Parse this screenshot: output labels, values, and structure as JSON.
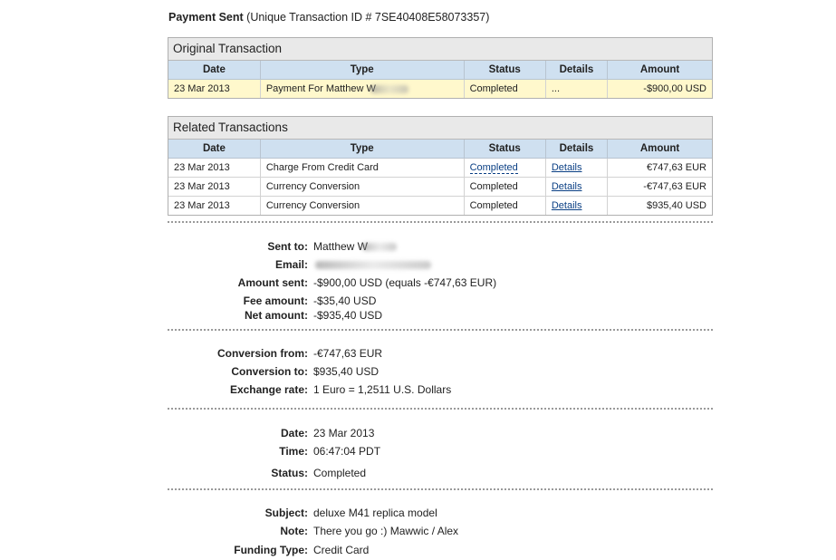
{
  "header": {
    "title": "Payment Sent",
    "transaction_id_text": "(Unique Transaction ID # 7SE40408E58073357)"
  },
  "original": {
    "title": "Original Transaction",
    "columns": [
      "Date",
      "Type",
      "Status",
      "Details",
      "Amount"
    ],
    "row": {
      "date": "23 Mar 2013",
      "type": "Payment For Matthew W",
      "status": "Completed",
      "details": "...",
      "amount": "-$900,00 USD"
    }
  },
  "related": {
    "title": "Related Transactions",
    "columns": [
      "Date",
      "Type",
      "Status",
      "Details",
      "Amount"
    ],
    "rows": [
      {
        "date": "23 Mar 2013",
        "type": "Charge From Credit Card",
        "status": "Completed",
        "details": "Details",
        "amount": "€747,63 EUR"
      },
      {
        "date": "23 Mar 2013",
        "type": "Currency Conversion",
        "status": "Completed",
        "details": "Details",
        "amount": "-€747,63 EUR"
      },
      {
        "date": "23 Mar 2013",
        "type": "Currency Conversion",
        "status": "Completed",
        "details": "Details",
        "amount": "$935,40 USD"
      }
    ]
  },
  "summary": {
    "sent_to_label": "Sent to:",
    "sent_to": "Matthew W",
    "email_label": "Email:",
    "amount_sent_label": "Amount sent:",
    "amount_sent": "-$900,00 USD (equals -€747,63 EUR)",
    "fee_label": "Fee amount:",
    "fee": "-$35,40 USD",
    "net_label": "Net amount:",
    "net": "-$935,40 USD"
  },
  "conversion": {
    "from_label": "Conversion from:",
    "from": "-€747,63 EUR",
    "to_label": "Conversion to:",
    "to": "$935,40 USD",
    "rate_label": "Exchange rate:",
    "rate": "1 Euro = 1,2511 U.S. Dollars"
  },
  "when": {
    "date_label": "Date:",
    "date": "23 Mar 2013",
    "time_label": "Time:",
    "time": "06:47:04 PDT",
    "status_label": "Status:",
    "status": "Completed"
  },
  "misc": {
    "subject_label": "Subject:",
    "subject": "deluxe M41 replica model",
    "note_label": "Note:",
    "note": "There you go :) Mawwic / Alex",
    "funding_label": "Funding Type:",
    "funding": "Credit Card"
  }
}
